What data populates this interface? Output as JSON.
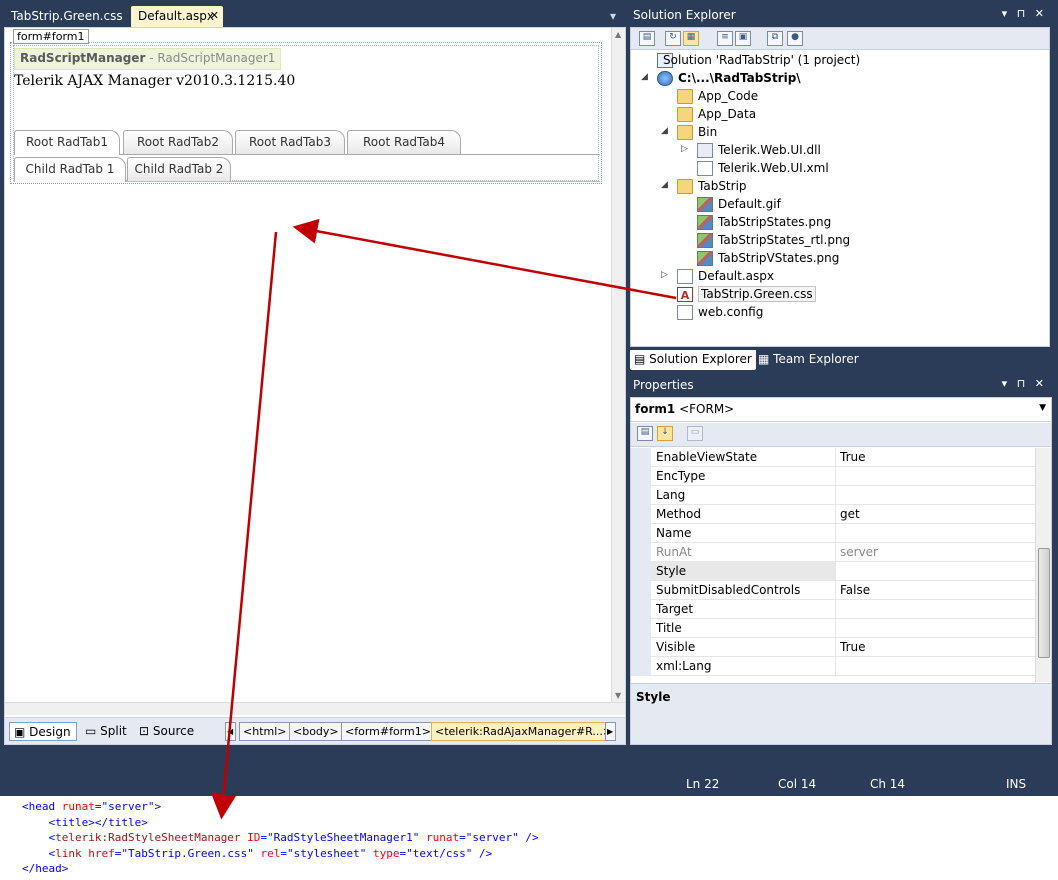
{
  "doc_tabs": {
    "tab1": "TabStrip.Green.css",
    "tab2": "Default.aspx",
    "close": "✕",
    "menu": "▾"
  },
  "design": {
    "form_tag": "form#form1",
    "script_manager_bold": "RadScriptManager",
    "script_manager_rest": " - RadScriptManager1",
    "ajax_manager": "Telerik AJAX Manager v2010.3.1215.40",
    "root_tabs": [
      "Root RadTab1",
      "Root RadTab2",
      "Root RadTab3",
      "Root RadTab4"
    ],
    "child_tabs": [
      "Child RadTab 1",
      "Child RadTab 2"
    ]
  },
  "view_bar": {
    "design": "Design",
    "split": "Split",
    "source": "Source",
    "crumbs": [
      "<html>",
      "<body>",
      "<form#form1>",
      "<telerik:RadAjaxManager#R...>"
    ]
  },
  "solution_explorer": {
    "title": "Solution Explorer",
    "controls": "▾ ⊓ ✕",
    "tree": {
      "solution": "Solution 'RadTabStrip' (1 project)",
      "project": "C:\\...\\RadTabStrip\\",
      "app_code": "App_Code",
      "app_data": "App_Data",
      "bin": "Bin",
      "dll": "Telerik.Web.UI.dll",
      "xml": "Telerik.Web.UI.xml",
      "tabstrip_folder": "TabStrip",
      "gif": "Default.gif",
      "states": "TabStripStates.png",
      "states_rtl": "TabStripStates_rtl.png",
      "vstates": "TabStripVStates.png",
      "default_aspx": "Default.aspx",
      "css": "TabStrip.Green.css",
      "webconfig": "web.config"
    },
    "tabs": {
      "se": "Solution Explorer",
      "te": "Team Explorer"
    }
  },
  "properties": {
    "title": "Properties",
    "controls": "▾ ⊓ ✕",
    "object_name": "form1",
    "object_type": "<FORM>",
    "rows": [
      {
        "name": "EnableViewState",
        "value": "True"
      },
      {
        "name": "EncType",
        "value": ""
      },
      {
        "name": "Lang",
        "value": ""
      },
      {
        "name": "Method",
        "value": "get"
      },
      {
        "name": "Name",
        "value": ""
      },
      {
        "name": "RunAt",
        "value": "server"
      },
      {
        "name": "Style",
        "value": ""
      },
      {
        "name": "SubmitDisabledControls",
        "value": "False"
      },
      {
        "name": "Target",
        "value": ""
      },
      {
        "name": "Title",
        "value": ""
      },
      {
        "name": "Visible",
        "value": "True"
      },
      {
        "name": "xml:Lang",
        "value": ""
      }
    ],
    "description": "Style"
  },
  "status": {
    "ln": "Ln 22",
    "col": "Col 14",
    "ch": "Ch 14",
    "ins": "INS"
  },
  "code": {
    "l1a": "<head ",
    "l1b": "runat",
    "l1c": "=\"server\"",
    "l1d": ">",
    "l2": "<title></title>",
    "l3a": "<",
    "l3b": "telerik:RadStyleSheetManager",
    "l3c": " ID",
    "l3d": "=\"RadStyleSheetManager1\"",
    "l3e": " runat",
    "l3f": "=\"server\"",
    "l3g": " />",
    "l4a": "<",
    "l4b": "link",
    "l4c": " href",
    "l4d": "=\"TabStrip.Green.css\"",
    "l4e": " rel",
    "l4f": "=\"stylesheet\"",
    "l4g": " type",
    "l4h": "=\"text/css\"",
    "l4i": " />",
    "l5": "</head>"
  },
  "colors": {
    "ide_bg": "#2b3c59",
    "arrow": "#c00000",
    "active_tab": "#fcf3cf"
  }
}
